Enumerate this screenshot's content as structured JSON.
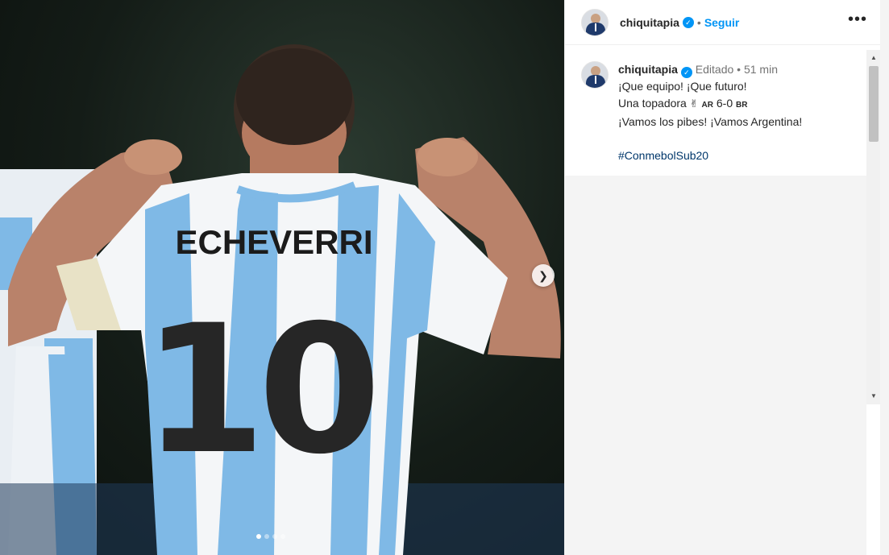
{
  "photo": {
    "jersey_name": "ECHEVERRI",
    "jersey_number": "10",
    "next_icon": "chevron-right-icon",
    "carousel_dots": 4,
    "active_dot": 0
  },
  "header": {
    "username": "chiquitapia",
    "verified_icon": "check-icon",
    "separator": "•",
    "follow_label": "Seguir",
    "more_icon": "•••"
  },
  "caption": {
    "username": "chiquitapia",
    "edited": "Editado",
    "separator": "•",
    "time": "51 min",
    "line1": "¡Que equipo! ¡Que futuro!",
    "line2_text": "Una topadora",
    "line2_emoji": "✌",
    "line2_flag1": "AR",
    "line2_score": "6-0",
    "line2_flag2": "BR",
    "line3": "¡Vamos los pibes! ¡Vamos Argentina!",
    "hashtag": "#ConmebolSub20"
  },
  "scrollbar": {
    "up_icon": "▲",
    "down_icon": "▼"
  },
  "colors": {
    "accent": "#0095f6",
    "hashtag": "#00376b",
    "jersey_blue": "#7fb9e6",
    "jersey_white": "#f4f6f8"
  }
}
